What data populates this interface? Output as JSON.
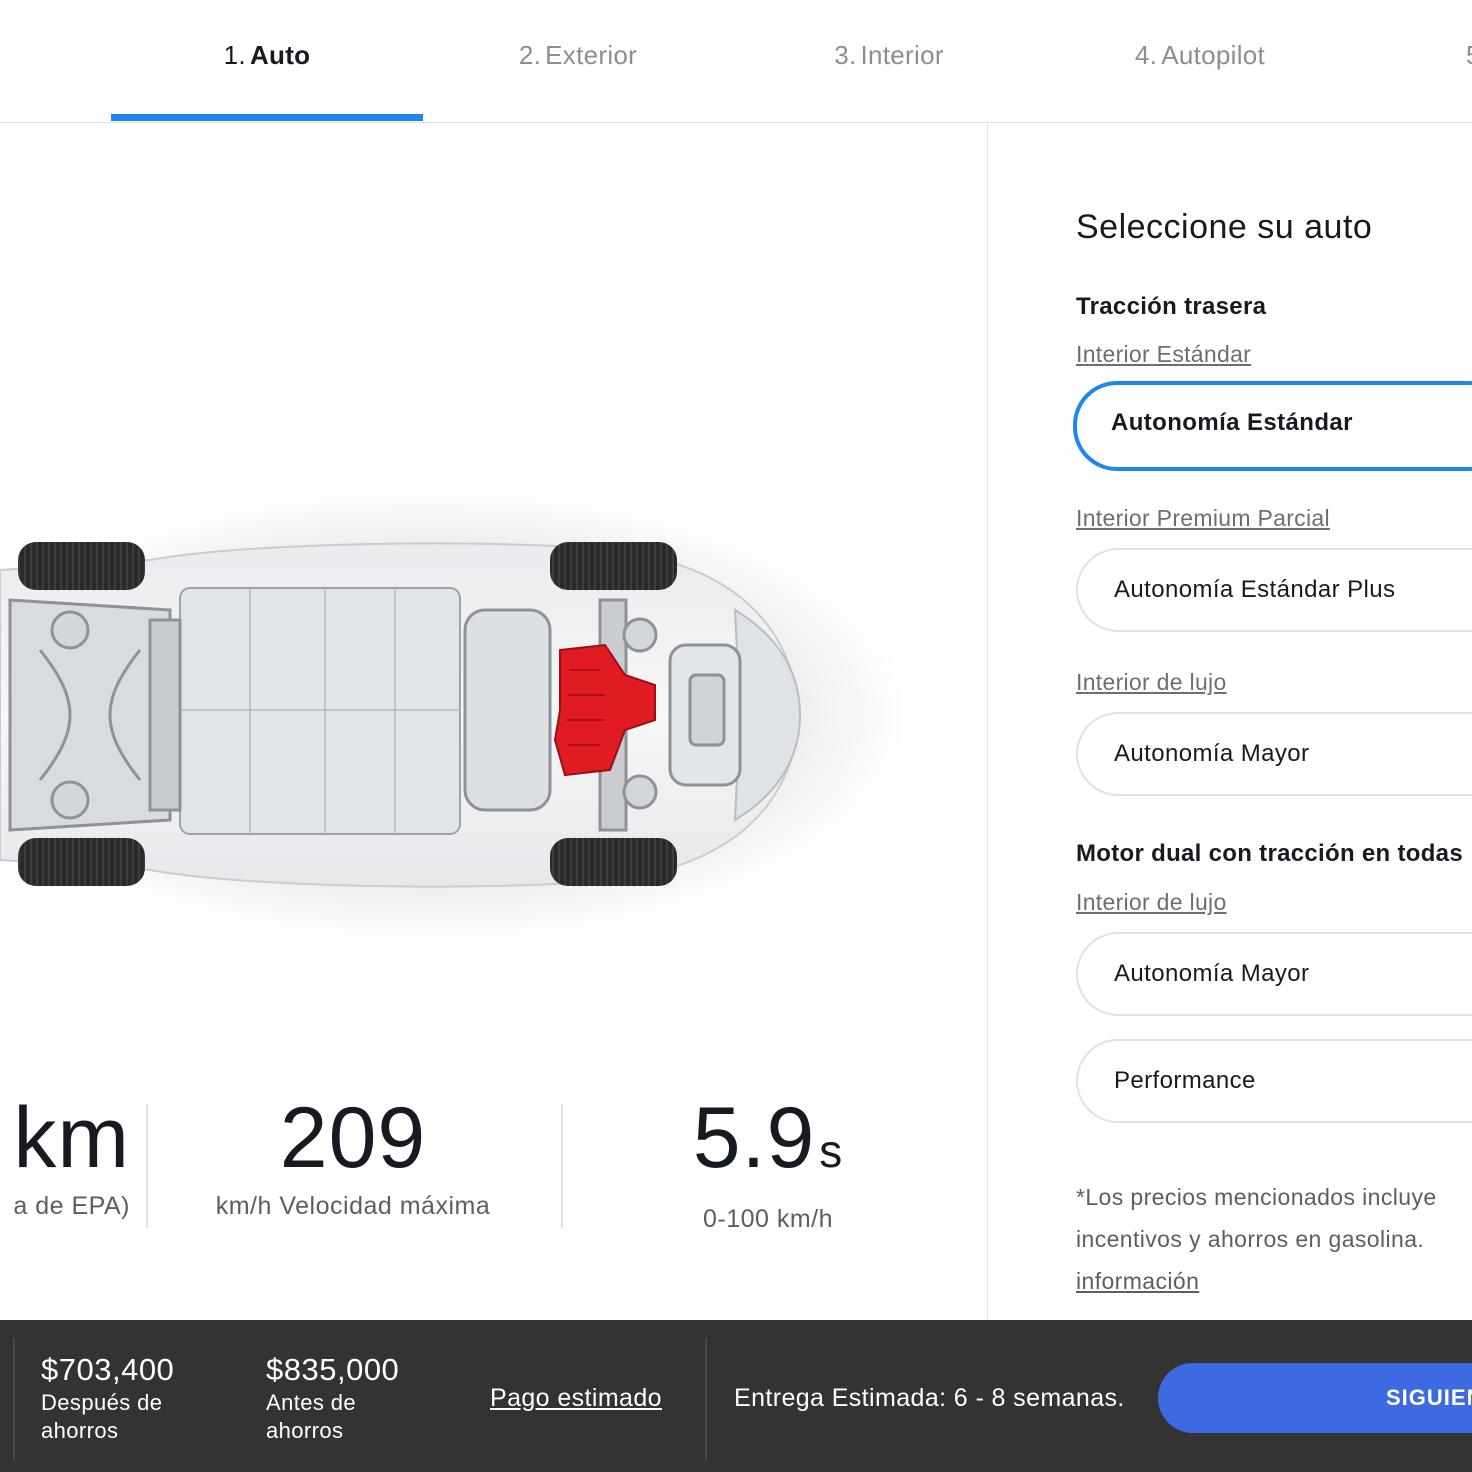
{
  "nav": {
    "tabs": [
      {
        "num": "1.",
        "label": "Auto",
        "active": true
      },
      {
        "num": "2.",
        "label": "Exterior"
      },
      {
        "num": "3.",
        "label": "Interior"
      },
      {
        "num": "4.",
        "label": "Autopilot"
      },
      {
        "num": "5",
        "label": ""
      }
    ],
    "accent": "#1f86f0"
  },
  "specs": [
    {
      "value": "km",
      "unit": "",
      "label": "a de EPA)"
    },
    {
      "value": "209",
      "unit": "",
      "label": "km/h Velocidad máxima"
    },
    {
      "value": "5.9",
      "unit": "s",
      "label": "0-100 km/h"
    }
  ],
  "panel": {
    "title": "Seleccione su auto",
    "groups": [
      {
        "title": "Tracción trasera",
        "sections": [
          {
            "link": "Interior Estándar",
            "options": [
              "Autonomía Estándar"
            ]
          },
          {
            "link": "Interior Premium Parcial",
            "options": [
              "Autonomía Estándar Plus"
            ]
          },
          {
            "link": "Interior de lujo",
            "options": [
              "Autonomía Mayor"
            ]
          }
        ]
      },
      {
        "title": "Motor dual con tracción en todas",
        "sections": [
          {
            "link": "Interior de lujo",
            "options": [
              "Autonomía Mayor",
              "Performance"
            ]
          }
        ]
      }
    ],
    "note_line1": "*Los precios mencionados incluye",
    "note_line2": "incentivos y ahorros en gasolina.",
    "note_more": "información"
  },
  "bar": {
    "after_amount": "$703,400",
    "after_caption_1": "Después de",
    "after_caption_2": "ahorros",
    "before_amount": "$835,000",
    "before_caption_1": "Antes de",
    "before_caption_2": "ahorros",
    "payment_link": "Pago estimado",
    "delivery": "Entrega Estimada: 6 - 8 semanas.",
    "next_button": "SIGUIEN",
    "button_color": "#3e6ae1"
  }
}
